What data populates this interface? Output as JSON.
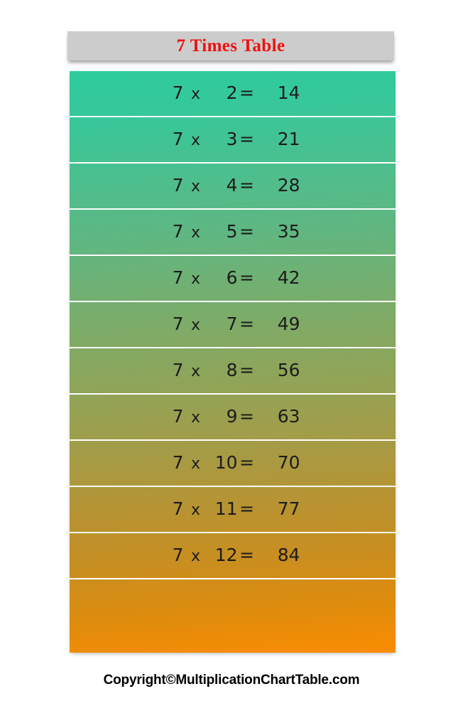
{
  "header": {
    "title": "7 Times Table",
    "title_color": "#ee1111",
    "bar_color": "#cccccc"
  },
  "table": {
    "multiplier": "7",
    "operator": "x",
    "equals": "=",
    "gradient_start": "#2ecc9e",
    "gradient_end": "#fa8c00",
    "divider_color": "#ffffff",
    "text_color": "#1c1c1c",
    "rows": [
      {
        "a": "7",
        "op": "x",
        "b": "2",
        "eq": "=",
        "product": "14"
      },
      {
        "a": "7",
        "op": "x",
        "b": "3",
        "eq": "=",
        "product": "21"
      },
      {
        "a": "7",
        "op": "x",
        "b": "4",
        "eq": "=",
        "product": "28"
      },
      {
        "a": "7",
        "op": "x",
        "b": "5",
        "eq": "=",
        "product": "35"
      },
      {
        "a": "7",
        "op": "x",
        "b": "6",
        "eq": "=",
        "product": "42"
      },
      {
        "a": "7",
        "op": "x",
        "b": "7",
        "eq": "=",
        "product": "49"
      },
      {
        "a": "7",
        "op": "x",
        "b": "8",
        "eq": "=",
        "product": "56"
      },
      {
        "a": "7",
        "op": "x",
        "b": "9",
        "eq": "=",
        "product": "63"
      },
      {
        "a": "7",
        "op": "x",
        "b": "10",
        "eq": "=",
        "product": "70"
      },
      {
        "a": "7",
        "op": "x",
        "b": "11",
        "eq": "=",
        "product": "77"
      },
      {
        "a": "7",
        "op": "x",
        "b": "12",
        "eq": "=",
        "product": "84"
      }
    ]
  },
  "footer": {
    "copyright": "Copyright©MultiplicationChartTable.com"
  }
}
